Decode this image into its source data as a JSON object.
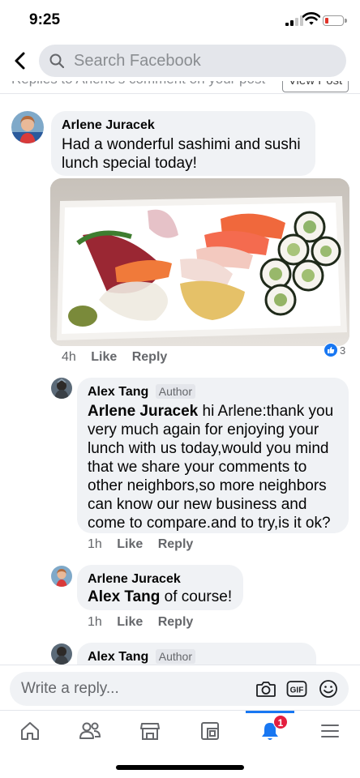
{
  "status_bar": {
    "time": "9:25"
  },
  "header": {
    "search_placeholder": "Search Facebook"
  },
  "context": {
    "text": "Replies to Arlene's comment on your post",
    "button": "View Post"
  },
  "comments": [
    {
      "author": "Arlene Juracek",
      "text": "Had a wonderful sashimi and sushi lunch special today!",
      "time": "4h",
      "like": "Like",
      "reply": "Reply",
      "reaction_count": "3"
    },
    {
      "author": "Alex Tang",
      "badge": "Author",
      "mention": "Arlene Juracek",
      "text_lines": [
        " hi Arlene:thank you",
        "very much again for enjoying your",
        "lunch with us today,would you mind",
        "that we share your comments to",
        "other neighbors,so more neighbors",
        "can know our new business and",
        "come to compare.and to try,is it ok?"
      ],
      "time": "1h",
      "like": "Like",
      "reply": "Reply"
    },
    {
      "author": "Arlene Juracek",
      "mention": "Alex Tang",
      "text": " of course!",
      "time": "1h",
      "like": "Like",
      "reply": "Reply"
    },
    {
      "author": "Alex Tang",
      "badge": "Author"
    }
  ],
  "composer": {
    "placeholder": "Write a reply..."
  },
  "tabbar": {
    "tabs": [
      "home",
      "friends",
      "marketplace",
      "pages",
      "notifications",
      "menu"
    ],
    "active": "notifications",
    "notification_badge": "1"
  },
  "colors": {
    "accent": "#1877f2",
    "badge": "#e41e3f",
    "bubble": "#f0f2f5"
  }
}
